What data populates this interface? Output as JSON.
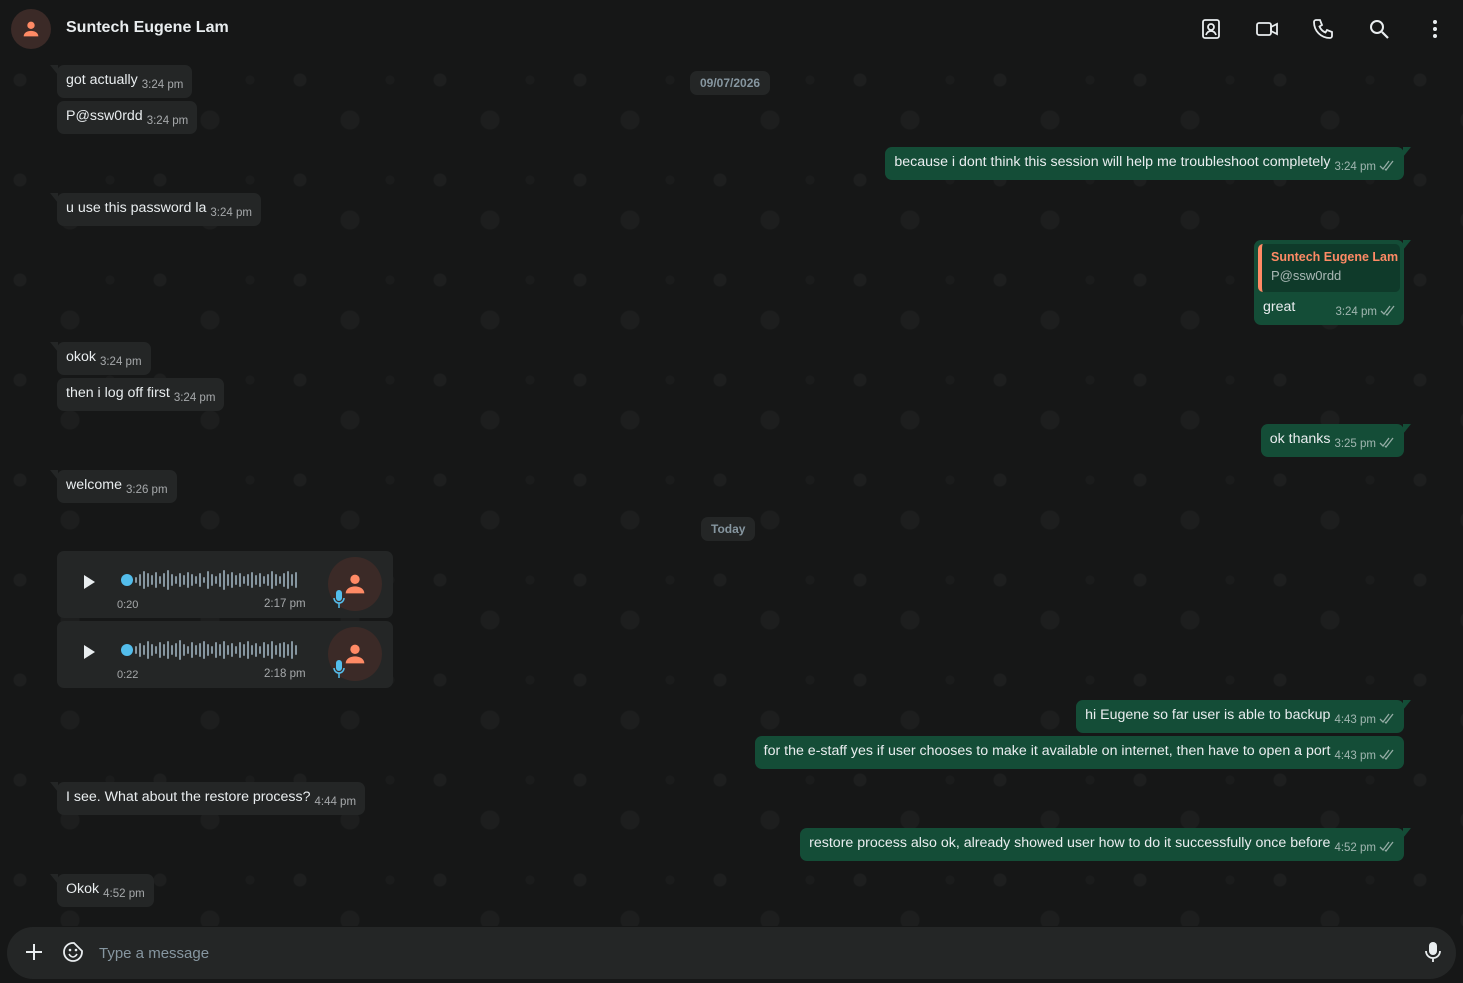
{
  "header": {
    "contact_name": "Suntech Eugene Lam",
    "icons": [
      "contacts-icon",
      "video-call-icon",
      "voice-call-icon",
      "search-icon",
      "more-options-icon"
    ]
  },
  "dates": {
    "first": "09/07/2026",
    "today": "Today"
  },
  "messages": {
    "m1": {
      "text": "got actually",
      "time": "3:24 pm"
    },
    "m2": {
      "text": "P@ssw0rdd",
      "time": "3:24 pm"
    },
    "m3": {
      "text": "because i dont think this session will help me troubleshoot completely",
      "time": "3:24 pm"
    },
    "m4": {
      "text": "u use this password la",
      "time": "3:24 pm"
    },
    "m5": {
      "quote_author": "Suntech Eugene Lam",
      "quote_text": "P@ssw0rdd",
      "text": "great",
      "time": "3:24 pm"
    },
    "m6": {
      "text": "okok",
      "time": "3:24 pm"
    },
    "m7": {
      "text": "then i log off first",
      "time": "3:24 pm"
    },
    "m8": {
      "text": "ok thanks",
      "time": "3:25 pm"
    },
    "m9": {
      "text": "welcome",
      "time": "3:26 pm"
    },
    "v1": {
      "duration": "0:20",
      "time": "2:17 pm"
    },
    "v2": {
      "duration": "0:22",
      "time": "2:18 pm"
    },
    "m10": {
      "text": "hi Eugene so far user is able to backup",
      "time": "4:43 pm"
    },
    "m11": {
      "text": "for the e-staff yes if user chooses to make it available on internet, then have to open a port",
      "time": "4:43 pm"
    },
    "m12": {
      "text": "I see. What about the restore process?",
      "time": "4:44 pm"
    },
    "m13": {
      "text": "restore process also ok, already showed user how to do it successfully once before",
      "time": "4:52 pm"
    },
    "m14": {
      "text": "Okok",
      "time": "4:52 pm"
    }
  },
  "composer": {
    "placeholder": "Type a message"
  },
  "colors": {
    "incoming_bubble": "#242626",
    "outgoing_bubble": "#144d37",
    "quote_accent": "#ff8a65",
    "voice_accent": "#53bdeb"
  }
}
